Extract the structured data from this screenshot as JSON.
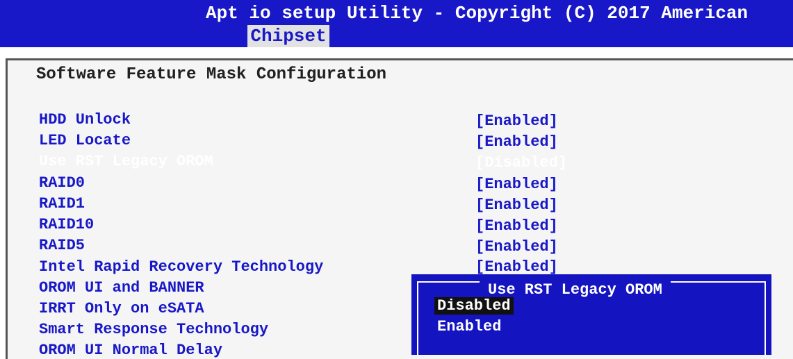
{
  "header": {
    "title": "Apt io setup Utility - Copyright (C) 2017 American",
    "tab": "Chipset"
  },
  "main": {
    "heading": "Software Feature Mask Configuration",
    "rows": [
      {
        "label": "HDD Unlock",
        "value": "[Enabled]"
      },
      {
        "label": "LED Locate",
        "value": "[Enabled]"
      },
      {
        "label": "Use RST Legacy OROM",
        "value": "[Disabled]"
      },
      {
        "label": "RAID0",
        "value": "[Enabled]"
      },
      {
        "label": "RAID1",
        "value": "[Enabled]"
      },
      {
        "label": "RAID10",
        "value": "[Enabled]"
      },
      {
        "label": "RAID5",
        "value": "[Enabled]"
      },
      {
        "label": "Intel Rapid Recovery Technology",
        "value": "[Enabled]"
      },
      {
        "label": "OROM UI and BANNER",
        "value": ""
      },
      {
        "label": "IRRT Only on eSATA",
        "value": ""
      },
      {
        "label": "Smart Response Technology",
        "value": ""
      },
      {
        "label": "OROM UI Normal Delay",
        "value": ""
      }
    ]
  },
  "popup": {
    "title": "Use RST Legacy OROM",
    "options": [
      "Disabled",
      "Enabled"
    ],
    "selected": "Disabled"
  },
  "colors": {
    "header_bg": "#1818c8",
    "label_text": "#1818c8",
    "popup_bg": "#1414c0",
    "highlight_bg": "#111111"
  }
}
